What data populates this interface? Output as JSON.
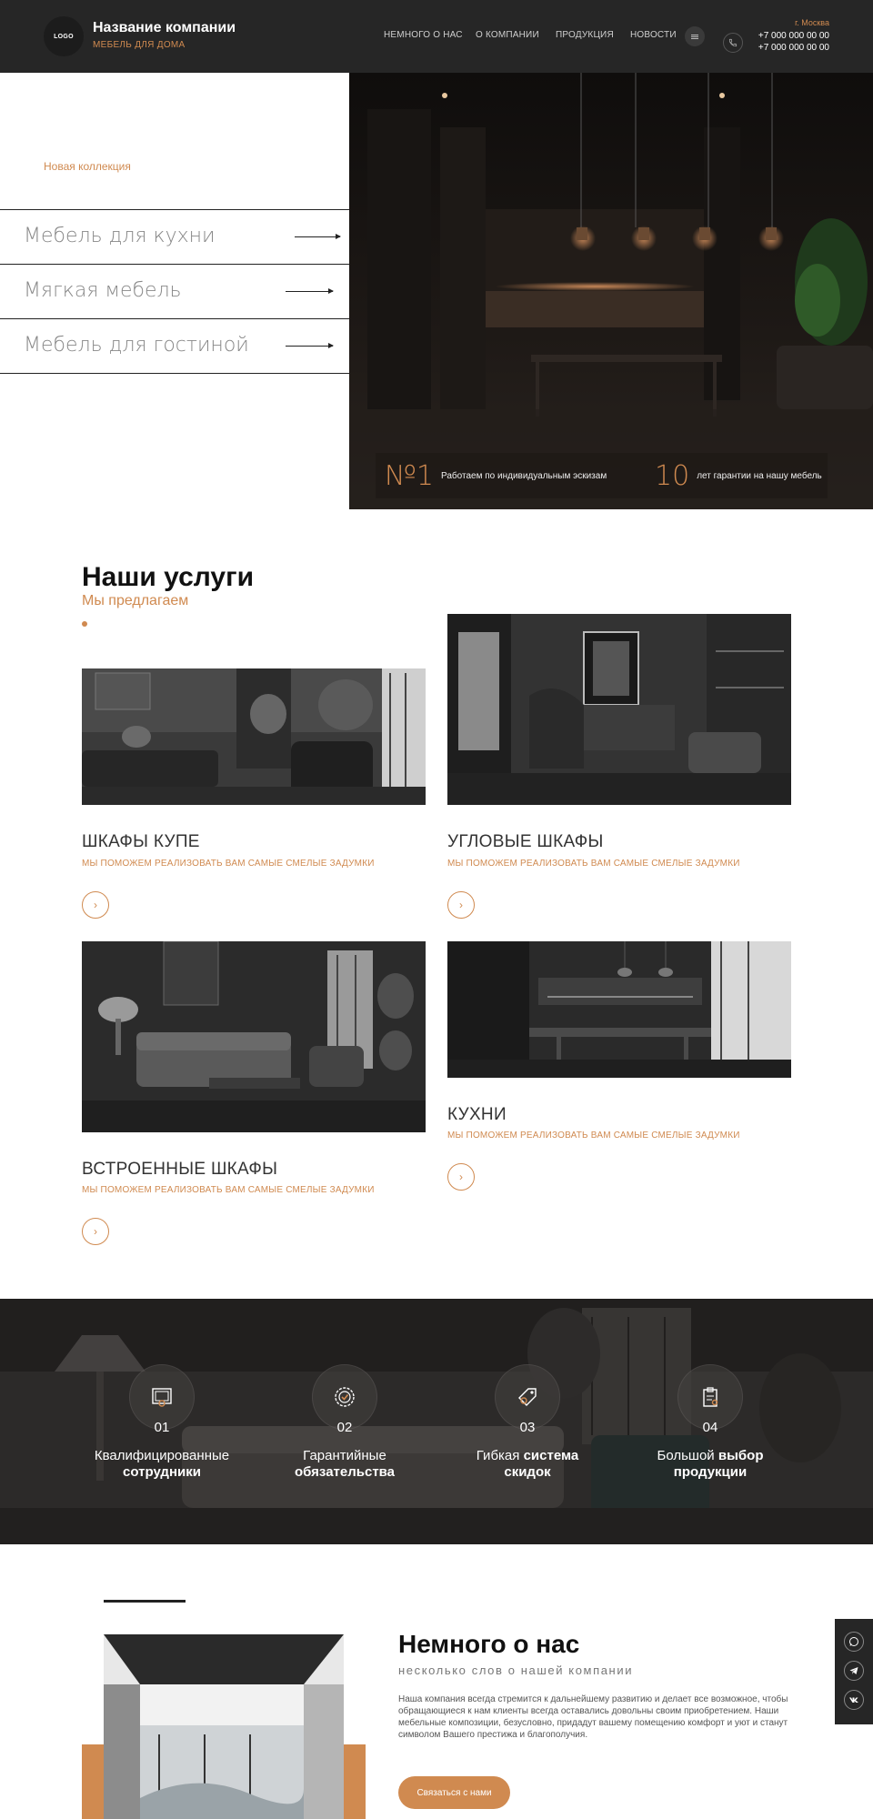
{
  "header": {
    "logo": "LOGO",
    "company_name": "Название компании",
    "company_sub": "МЕБЕЛЬ ДЛЯ ДОМА",
    "nav": [
      "НЕМНОГО О НАС",
      "О КОМПАНИИ",
      "ПРОДУКЦИЯ",
      "НОВОСТИ"
    ],
    "city": "г. Москва",
    "phones": [
      "+7 000 000 00 00",
      "+7 000 000 00 00"
    ]
  },
  "hero": {
    "collection_label": "Новая коллекция",
    "categories": [
      "Мебель для кухни",
      "Мягкая мебель",
      "Мебель для гостиной"
    ],
    "stats": [
      {
        "num": "№1",
        "text": "Работаем по индивидуальным эскизам"
      },
      {
        "num": "10",
        "text": "лет гарантии на нашу мебель"
      }
    ]
  },
  "services": {
    "title": "Наши услуги",
    "subtitle": "Мы предлагаем",
    "items": [
      {
        "title": "ШКАФЫ КУПЕ",
        "desc": "МЫ ПОМОЖЕМ РЕАЛИЗОВАТЬ ВАМ САМЫЕ СМЕЛЫЕ ЗАДУМКИ"
      },
      {
        "title": "УГЛОВЫЕ ШКАФЫ",
        "desc": "МЫ ПОМОЖЕМ РЕАЛИЗОВАТЬ ВАМ САМЫЕ СМЕЛЫЕ ЗАДУМКИ"
      },
      {
        "title": "ВСТРОЕННЫЕ ШКАФЫ",
        "desc": "МЫ ПОМОЖЕМ РЕАЛИЗОВАТЬ ВАМ САМЫЕ СМЕЛЫЕ ЗАДУМКИ"
      },
      {
        "title": "КУХНИ",
        "desc": "МЫ ПОМОЖЕМ РЕАЛИЗОВАТЬ ВАМ САМЫЕ СМЕЛЫЕ ЗАДУМКИ"
      }
    ]
  },
  "benefits": [
    {
      "num": "01",
      "line1": "Квалифицированные",
      "line2": "сотрудники"
    },
    {
      "num": "02",
      "line1": "Гарантийные",
      "line2": "обязательства"
    },
    {
      "num": "03",
      "line1a": "Гибкая ",
      "line1b": "система",
      "line2": "скидок"
    },
    {
      "num": "04",
      "line1a": "Большой ",
      "line1b": "выбор",
      "line2": "продукции"
    }
  ],
  "about": {
    "title": "Немного о нас",
    "subtitle": "несколько слов о нашей компании",
    "text": "Наша компания всегда стремится к дальнейшему развитию и делает все возможное, чтобы обращающиеся к нам клиенты всегда оставались довольны своим приобретением. Наши мебельные композиции, безусловно, придадут вашему помещению комфорт и уют и станут символом Вашего престижа и благополучия.",
    "button": "Связаться с нами"
  },
  "social": [
    "whatsapp-icon",
    "telegram-icon",
    "vk-icon"
  ],
  "colors": {
    "accent": "#d08a50",
    "dark": "#262626"
  }
}
